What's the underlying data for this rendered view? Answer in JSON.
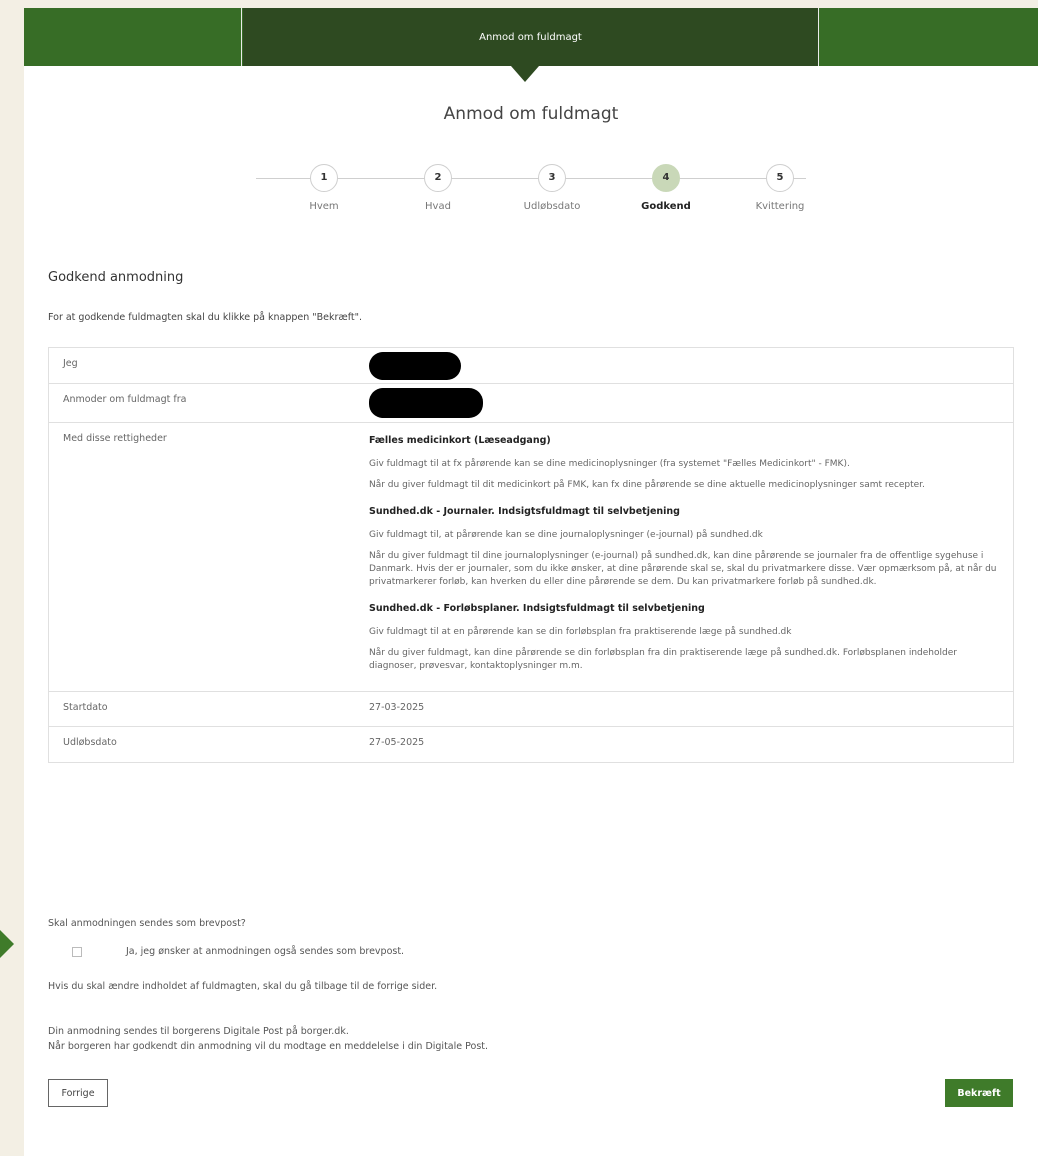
{
  "header": {
    "title": "Anmod om fuldmagt"
  },
  "page_title": "Anmod om fuldmagt",
  "steps": [
    {
      "number": "1",
      "label": "Hvem"
    },
    {
      "number": "2",
      "label": "Hvad"
    },
    {
      "number": "3",
      "label": "Udløbsdato"
    },
    {
      "number": "4",
      "label": "Godkend"
    },
    {
      "number": "5",
      "label": "Kvittering"
    }
  ],
  "active_step": 4,
  "section": {
    "title": "Godkend anmodning",
    "intro": "For at godkende fuldmagten skal du klikke på knappen \"Bekræft\"."
  },
  "table": {
    "rows": {
      "me_label": "Jeg",
      "from_label": "Anmoder om fuldmagt fra",
      "rights_label": "Med disse rettigheder",
      "start_label": "Startdato",
      "start_value": "27-03-2025",
      "end_label": "Udløbsdato",
      "end_value": "27-05-2025"
    },
    "rights": [
      {
        "title": "Fælles medicinkort (Læseadgang)",
        "p1": "Giv fuldmagt til at fx pårørende kan se dine medicinoplysninger (fra systemet \"Fælles Medicinkort\" - FMK).",
        "p2": "Når du giver fuldmagt til dit medicinkort på FMK, kan fx dine pårørende se dine aktuelle medicinoplysninger samt recepter."
      },
      {
        "title": "Sundhed.dk - Journaler. Indsigtsfuldmagt til selvbetjening",
        "p1": "Giv fuldmagt til, at pårørende kan se dine journaloplysninger (e-journal) på sundhed.dk",
        "p2": "Når du giver fuldmagt til dine journaloplysninger (e-journal) på sundhed.dk, kan dine pårørende se journaler fra de offentlige sygehuse i Danmark. Hvis der er journaler, som du ikke ønsker, at dine pårørende skal se, skal du privatmarkere disse. Vær opmærksom på, at når du privatmarkerer forløb, kan hverken du eller dine pårørende se dem. Du kan privatmarkere forløb på sundhed.dk."
      },
      {
        "title": "Sundhed.dk - Forløbsplaner. Indsigtsfuldmagt til selvbetjening",
        "p1": "Giv fuldmagt til at en pårørende kan se din forløbsplan fra praktiserende læge på sundhed.dk",
        "p2": "Når du giver fuldmagt, kan dine pårørende se din forløbsplan fra din praktiserende læge på sundhed.dk. Forløbsplanen indeholder diagnoser, prøvesvar, kontaktoplysninger m.m."
      }
    ]
  },
  "letter": {
    "question": "Skal anmodningen sendes som brevpost?",
    "checkbox_label": "Ja, jeg ønsker at anmodningen også sendes som brevpost.",
    "checked": false
  },
  "notes": {
    "edit": "Hvis du skal ændre indholdet af fuldmagten, skal du gå tilbage til de forrige sider.",
    "line1": "Din anmodning sendes til borgerens Digitale Post på borger.dk.",
    "line2": "Når borgeren har godkendt din anmodning vil du modtage en meddelelse i din Digitale Post."
  },
  "buttons": {
    "previous": "Forrige",
    "confirm": "Bekræft"
  },
  "colors": {
    "brand_green": "#376d26",
    "dark_green": "#2e4a21",
    "button_green": "#3f7b2a",
    "active_step": "#c9d8b8"
  }
}
